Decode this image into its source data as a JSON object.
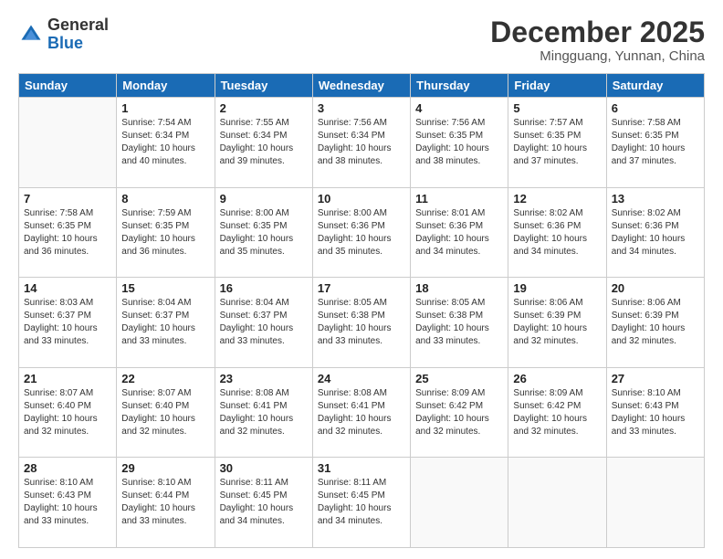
{
  "header": {
    "logo_general": "General",
    "logo_blue": "Blue",
    "month_title": "December 2025",
    "location": "Mingguang, Yunnan, China"
  },
  "weekdays": [
    "Sunday",
    "Monday",
    "Tuesday",
    "Wednesday",
    "Thursday",
    "Friday",
    "Saturday"
  ],
  "weeks": [
    [
      {
        "day": "",
        "text": ""
      },
      {
        "day": "1",
        "text": "Sunrise: 7:54 AM\nSunset: 6:34 PM\nDaylight: 10 hours\nand 40 minutes."
      },
      {
        "day": "2",
        "text": "Sunrise: 7:55 AM\nSunset: 6:34 PM\nDaylight: 10 hours\nand 39 minutes."
      },
      {
        "day": "3",
        "text": "Sunrise: 7:56 AM\nSunset: 6:34 PM\nDaylight: 10 hours\nand 38 minutes."
      },
      {
        "day": "4",
        "text": "Sunrise: 7:56 AM\nSunset: 6:35 PM\nDaylight: 10 hours\nand 38 minutes."
      },
      {
        "day": "5",
        "text": "Sunrise: 7:57 AM\nSunset: 6:35 PM\nDaylight: 10 hours\nand 37 minutes."
      },
      {
        "day": "6",
        "text": "Sunrise: 7:58 AM\nSunset: 6:35 PM\nDaylight: 10 hours\nand 37 minutes."
      }
    ],
    [
      {
        "day": "7",
        "text": "Sunrise: 7:58 AM\nSunset: 6:35 PM\nDaylight: 10 hours\nand 36 minutes."
      },
      {
        "day": "8",
        "text": "Sunrise: 7:59 AM\nSunset: 6:35 PM\nDaylight: 10 hours\nand 36 minutes."
      },
      {
        "day": "9",
        "text": "Sunrise: 8:00 AM\nSunset: 6:35 PM\nDaylight: 10 hours\nand 35 minutes."
      },
      {
        "day": "10",
        "text": "Sunrise: 8:00 AM\nSunset: 6:36 PM\nDaylight: 10 hours\nand 35 minutes."
      },
      {
        "day": "11",
        "text": "Sunrise: 8:01 AM\nSunset: 6:36 PM\nDaylight: 10 hours\nand 34 minutes."
      },
      {
        "day": "12",
        "text": "Sunrise: 8:02 AM\nSunset: 6:36 PM\nDaylight: 10 hours\nand 34 minutes."
      },
      {
        "day": "13",
        "text": "Sunrise: 8:02 AM\nSunset: 6:36 PM\nDaylight: 10 hours\nand 34 minutes."
      }
    ],
    [
      {
        "day": "14",
        "text": "Sunrise: 8:03 AM\nSunset: 6:37 PM\nDaylight: 10 hours\nand 33 minutes."
      },
      {
        "day": "15",
        "text": "Sunrise: 8:04 AM\nSunset: 6:37 PM\nDaylight: 10 hours\nand 33 minutes."
      },
      {
        "day": "16",
        "text": "Sunrise: 8:04 AM\nSunset: 6:37 PM\nDaylight: 10 hours\nand 33 minutes."
      },
      {
        "day": "17",
        "text": "Sunrise: 8:05 AM\nSunset: 6:38 PM\nDaylight: 10 hours\nand 33 minutes."
      },
      {
        "day": "18",
        "text": "Sunrise: 8:05 AM\nSunset: 6:38 PM\nDaylight: 10 hours\nand 33 minutes."
      },
      {
        "day": "19",
        "text": "Sunrise: 8:06 AM\nSunset: 6:39 PM\nDaylight: 10 hours\nand 32 minutes."
      },
      {
        "day": "20",
        "text": "Sunrise: 8:06 AM\nSunset: 6:39 PM\nDaylight: 10 hours\nand 32 minutes."
      }
    ],
    [
      {
        "day": "21",
        "text": "Sunrise: 8:07 AM\nSunset: 6:40 PM\nDaylight: 10 hours\nand 32 minutes."
      },
      {
        "day": "22",
        "text": "Sunrise: 8:07 AM\nSunset: 6:40 PM\nDaylight: 10 hours\nand 32 minutes."
      },
      {
        "day": "23",
        "text": "Sunrise: 8:08 AM\nSunset: 6:41 PM\nDaylight: 10 hours\nand 32 minutes."
      },
      {
        "day": "24",
        "text": "Sunrise: 8:08 AM\nSunset: 6:41 PM\nDaylight: 10 hours\nand 32 minutes."
      },
      {
        "day": "25",
        "text": "Sunrise: 8:09 AM\nSunset: 6:42 PM\nDaylight: 10 hours\nand 32 minutes."
      },
      {
        "day": "26",
        "text": "Sunrise: 8:09 AM\nSunset: 6:42 PM\nDaylight: 10 hours\nand 32 minutes."
      },
      {
        "day": "27",
        "text": "Sunrise: 8:10 AM\nSunset: 6:43 PM\nDaylight: 10 hours\nand 33 minutes."
      }
    ],
    [
      {
        "day": "28",
        "text": "Sunrise: 8:10 AM\nSunset: 6:43 PM\nDaylight: 10 hours\nand 33 minutes."
      },
      {
        "day": "29",
        "text": "Sunrise: 8:10 AM\nSunset: 6:44 PM\nDaylight: 10 hours\nand 33 minutes."
      },
      {
        "day": "30",
        "text": "Sunrise: 8:11 AM\nSunset: 6:45 PM\nDaylight: 10 hours\nand 34 minutes."
      },
      {
        "day": "31",
        "text": "Sunrise: 8:11 AM\nSunset: 6:45 PM\nDaylight: 10 hours\nand 34 minutes."
      },
      {
        "day": "",
        "text": ""
      },
      {
        "day": "",
        "text": ""
      },
      {
        "day": "",
        "text": ""
      }
    ]
  ]
}
